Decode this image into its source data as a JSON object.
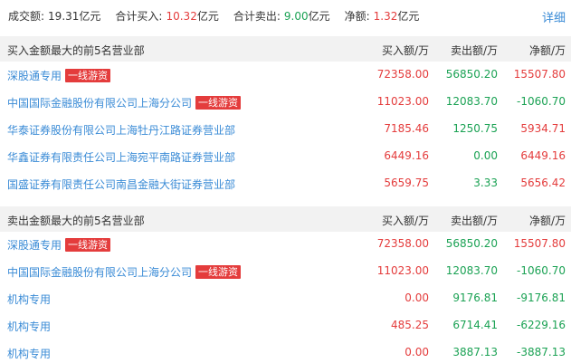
{
  "summary": {
    "turnover_label": "成交额:",
    "turnover_value": "19.31",
    "turnover_unit": "亿元",
    "total_buy_label": "合计买入:",
    "total_buy_value": "10.32",
    "total_buy_unit": "亿元",
    "total_sell_label": "合计卖出:",
    "total_sell_value": "9.00",
    "total_sell_unit": "亿元",
    "net_label": "净额:",
    "net_value": "1.32",
    "net_unit": "亿元",
    "detail_link": "详细"
  },
  "buy_section": {
    "title": "买入金额最大的前5名营业部",
    "col_buy": "买入额/万",
    "col_sell": "卖出额/万",
    "col_net": "净额/万",
    "rows": [
      {
        "name": "深股通专用",
        "tag": "一线游资",
        "buy": "72358.00",
        "sell": "56850.20",
        "net": "15507.80"
      },
      {
        "name": "中国国际金融股份有限公司上海分公司",
        "tag": "一线游资",
        "buy": "11023.00",
        "sell": "12083.70",
        "net": "-1060.70"
      },
      {
        "name": "华泰证券股份有限公司上海牡丹江路证券营业部",
        "tag": "",
        "buy": "7185.46",
        "sell": "1250.75",
        "net": "5934.71"
      },
      {
        "name": "华鑫证券有限责任公司上海宛平南路证券营业部",
        "tag": "",
        "buy": "6449.16",
        "sell": "0.00",
        "net": "6449.16"
      },
      {
        "name": "国盛证券有限责任公司南昌金融大街证券营业部",
        "tag": "",
        "buy": "5659.75",
        "sell": "3.33",
        "net": "5656.42"
      }
    ]
  },
  "sell_section": {
    "title": "卖出金额最大的前5名营业部",
    "col_buy": "买入额/万",
    "col_sell": "卖出额/万",
    "col_net": "净额/万",
    "rows": [
      {
        "name": "深股通专用",
        "tag": "一线游资",
        "buy": "72358.00",
        "sell": "56850.20",
        "net": "15507.80"
      },
      {
        "name": "中国国际金融股份有限公司上海分公司",
        "tag": "一线游资",
        "buy": "11023.00",
        "sell": "12083.70",
        "net": "-1060.70"
      },
      {
        "name": "机构专用",
        "tag": "",
        "buy": "0.00",
        "sell": "9176.81",
        "net": "-9176.81"
      },
      {
        "name": "机构专用",
        "tag": "",
        "buy": "485.25",
        "sell": "6714.41",
        "net": "-6229.16"
      },
      {
        "name": "机构专用",
        "tag": "",
        "buy": "0.00",
        "sell": "3887.13",
        "net": "-3887.13"
      }
    ]
  },
  "colors": {
    "up": "#e43c3c",
    "down": "#1ba254",
    "link": "#3a8bd6",
    "header_bg": "#f2f2f2"
  }
}
